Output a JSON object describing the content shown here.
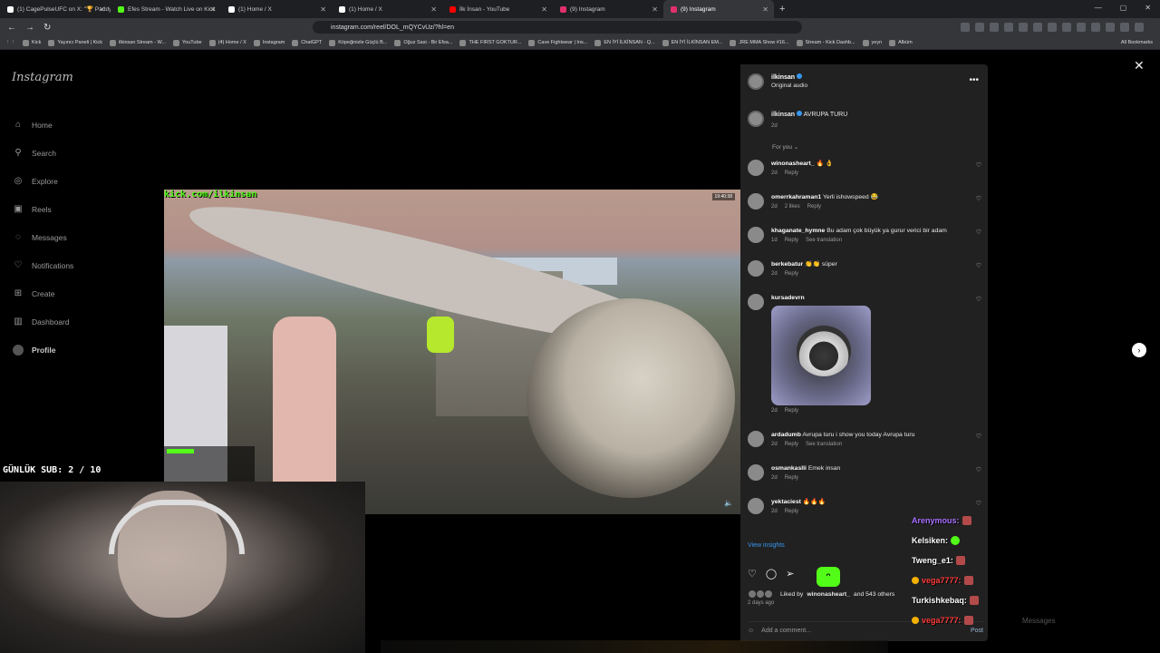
{
  "browser": {
    "tabs": [
      {
        "label": "(1) CagePulseUFC on X: \"🏆 Paddy P",
        "color": "#ffffff"
      },
      {
        "label": "Efes Stream - Watch Live on Kick",
        "color": "#53fc18"
      },
      {
        "label": "(1) Home / X",
        "color": "#ffffff"
      },
      {
        "label": "(1) Home / X",
        "color": "#ffffff"
      },
      {
        "label": "İlk İnsan - YouTube",
        "color": "#ff0000"
      },
      {
        "label": "(9) Instagram",
        "color": "#e1306c"
      },
      {
        "label": "(9) Instagram",
        "color": "#e1306c"
      }
    ],
    "url": "instagram.com/reel/DOL_mQYCvUz/?hl=en",
    "bookmarks": [
      "Kick",
      "Yayıncı Paneli | Kick",
      "ilkinsan Stream - W...",
      "YouTube",
      "(4) Home / X",
      "Instagram",
      "ChatGPT",
      "Köpeğinizle Güçlü B...",
      "Oğuz Sasi - Bir Efsa...",
      "THE FIRST GOKTUR...",
      "Cave Fightwear | Ins...",
      "EN İYİ İLKİNSAN - Q...",
      "EN İYİ İLKİNSAN EM...",
      "JRE MMA Show #16...",
      "Stream - Kick Dashb...",
      "yeyn",
      "Albüm"
    ],
    "all_bookmarks": "All Bookmarks"
  },
  "instagram": {
    "logo": "Instagram",
    "nav": [
      {
        "label": "Home",
        "icon": "home-icon",
        "glyph": "⌂"
      },
      {
        "label": "Search",
        "icon": "search-icon",
        "glyph": "⚲"
      },
      {
        "label": "Explore",
        "icon": "compass-icon",
        "glyph": "◎"
      },
      {
        "label": "Reels",
        "icon": "reels-icon",
        "glyph": "▣"
      },
      {
        "label": "Messages",
        "icon": "messenger-icon",
        "glyph": "◌"
      },
      {
        "label": "Notifications",
        "icon": "heart-icon",
        "glyph": "♡"
      },
      {
        "label": "Create",
        "icon": "plus-icon",
        "glyph": "⊞"
      },
      {
        "label": "Dashboard",
        "icon": "dashboard-icon",
        "glyph": "▥"
      },
      {
        "label": "Profile",
        "icon": "avatar-icon",
        "glyph": ""
      }
    ]
  },
  "stream": {
    "kick_url": "kick.com/ilkinsan",
    "sub_goal": "GÜNLÜK SUB: 2 / 10",
    "overlay_time": "19:40:38"
  },
  "reel": {
    "author": "ilkinsan",
    "audio": "Original audio",
    "caption_author": "ilkinsan",
    "caption_text": "AVRUPA TURU",
    "caption_time": "2d",
    "sort_label": "For you ⌄",
    "comments": [
      {
        "user": "winonasheart_",
        "text": "🔥 👌",
        "time": "2d",
        "likes": "",
        "reply": "Reply",
        "translate": ""
      },
      {
        "user": "omerrkahraman1",
        "text": "Yerli ishowspeed 😂",
        "time": "2d",
        "likes": "2 likes",
        "reply": "Reply",
        "translate": ""
      },
      {
        "user": "khaganate_hymne",
        "text": "Bu adam çok büyük ya gurur verici bir adam",
        "time": "1d",
        "likes": "",
        "reply": "Reply",
        "translate": "See translation"
      },
      {
        "user": "berkebatur",
        "text": "👏👏 süper",
        "time": "2d",
        "likes": "",
        "reply": "Reply",
        "translate": ""
      },
      {
        "user": "kursadevrn",
        "text": "",
        "time": "2d",
        "likes": "",
        "reply": "Reply",
        "translate": "",
        "sticker": true
      },
      {
        "user": "ardadumb",
        "text": "Avrupa turu i show you today Avrupa turu",
        "time": "2d",
        "likes": "",
        "reply": "Reply",
        "translate": "See translation"
      },
      {
        "user": "osmankaslli",
        "text": "Emek insan",
        "time": "2d",
        "likes": "",
        "reply": "Reply",
        "translate": ""
      },
      {
        "user": "yektaciest",
        "text": "🔥🔥🔥",
        "time": "2d",
        "likes": "",
        "reply": "Reply",
        "translate": ""
      }
    ],
    "view_insights": "View insights",
    "liked_by_prefix": "Liked by",
    "liked_by_user": "winonasheart_",
    "liked_by_suffix": "and 543 others",
    "date": "2 days ago",
    "add_comment_placeholder": "Add a comment...",
    "post_label": "Post"
  },
  "chat_overlay": [
    {
      "name": "Arenymous:",
      "color": "#a970ff"
    },
    {
      "name": "Kelsiken:",
      "color": "#ffffff"
    },
    {
      "name": "Tweng_e1:",
      "color": "#ffffff"
    },
    {
      "name": "vega7777:",
      "color": "#ff3b3b"
    },
    {
      "name": "Turkishkebaq:",
      "color": "#ffffff"
    },
    {
      "name": "vega7777:",
      "color": "#ff3b3b"
    }
  ],
  "messages_float": "Messages"
}
